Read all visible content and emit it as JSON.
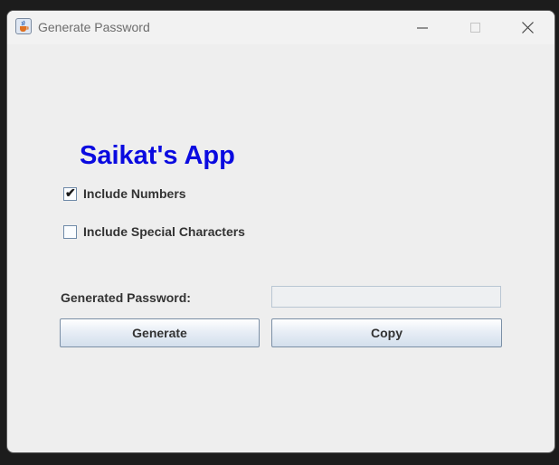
{
  "window": {
    "title": "Generate Password",
    "controls": {
      "minimize": "minimize-icon",
      "maximize": "maximize-icon",
      "close": "close-icon"
    },
    "app_icon": "java-cup-icon"
  },
  "app": {
    "heading": "Saikat's App",
    "heading_color": "#0a0ae0",
    "options": [
      {
        "label": "Include Numbers",
        "checked": true
      },
      {
        "label": "Include Special Characters",
        "checked": false
      }
    ],
    "password_label": "Generated Password:",
    "password_value": "",
    "generate_button": "Generate",
    "copy_button": "Copy"
  }
}
